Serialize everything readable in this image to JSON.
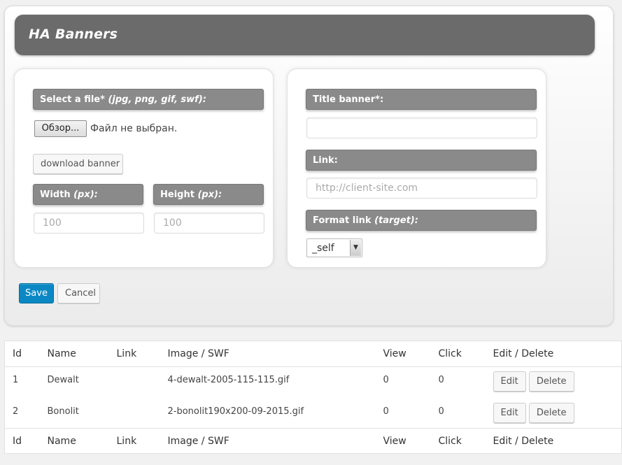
{
  "header": {
    "title": "HA Banners"
  },
  "left_card": {
    "file_label": "Select a file*",
    "file_label_hint": "(jpg, png, gif, swf):",
    "browse_button": "Обзор...",
    "file_status": "Файл не выбран.",
    "download_button": "download banner",
    "width_label": "Width",
    "width_hint": "(px):",
    "width_placeholder": "100",
    "height_label": "Height",
    "height_hint": "(px):",
    "height_placeholder": "100"
  },
  "right_card": {
    "title_label": "Title banner*:",
    "title_value": "",
    "link_label": "Link:",
    "link_placeholder": "http://client-site.com",
    "format_label": "Format link",
    "format_hint": "(target):",
    "format_selected": "_self"
  },
  "actions": {
    "save": "Save",
    "cancel": "Cancel"
  },
  "table": {
    "columns": [
      "Id",
      "Name",
      "Link",
      "Image / SWF",
      "View",
      "Click",
      "Edit / Delete"
    ],
    "rows": [
      {
        "id": "1",
        "name": "Dewalt",
        "link": "",
        "image": "4-dewalt-2005-115-115.gif",
        "view": "0",
        "click": "0",
        "edit": "Edit",
        "delete": "Delete"
      },
      {
        "id": "2",
        "name": "Bonolit",
        "link": "",
        "image": "2-bonolit190x200-09-2015.gif",
        "view": "0",
        "click": "0",
        "edit": "Edit",
        "delete": "Delete"
      }
    ]
  },
  "colors": {
    "accent": "#0b88c4",
    "header_bg": "#6b6b6b",
    "label_bg": "#8a8a8a"
  }
}
